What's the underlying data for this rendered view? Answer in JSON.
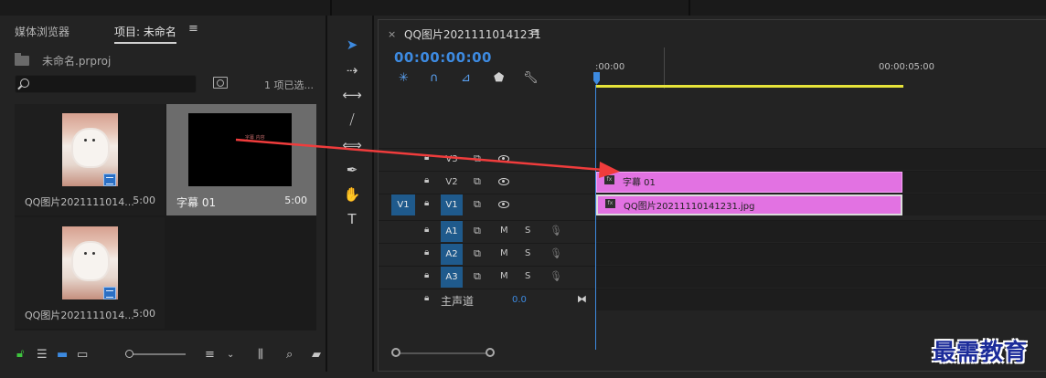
{
  "project_panel": {
    "tabs": [
      "媒体浏览器",
      "项目: 未命名"
    ],
    "menu_icon": "≡",
    "file_name": "未命名.prproj",
    "search_placeholder": "",
    "selection_count": "1 项已选...",
    "items": [
      {
        "name": "QQ图片2021111014...",
        "duration": "5:00",
        "type": "image",
        "badge": "image-icon"
      },
      {
        "name": "字幕 01",
        "duration": "5:00",
        "type": "title",
        "selected": true,
        "thumb_text": "字幕 内容"
      },
      {
        "name": "QQ图片2021111014...",
        "duration": "5:00",
        "type": "image",
        "badge": "sequence-icon"
      }
    ]
  },
  "tools": [
    "selection-tool",
    "track-select-tool",
    "ripple-edit-tool",
    "razor-tool",
    "slip-tool",
    "pen-tool",
    "hand-tool",
    "type-tool"
  ],
  "timeline": {
    "sequence_name": "QQ图片20211110141231",
    "close_symbol": "×",
    "menu_icon": "≡",
    "timecode": "00:00:00:00",
    "ruler_labels": [
      ":00:00",
      "00:00:05:00"
    ],
    "video_tracks": [
      {
        "name": "V3",
        "source_patch": ""
      },
      {
        "name": "V2",
        "source_patch": ""
      },
      {
        "name": "V1",
        "source_patch": "V1"
      }
    ],
    "audio_tracks": [
      {
        "name": "A1",
        "m": "M",
        "s": "S"
      },
      {
        "name": "A2",
        "m": "M",
        "s": "S"
      },
      {
        "name": "A3",
        "m": "M",
        "s": "S"
      }
    ],
    "master": {
      "label": "主声道",
      "value": "0.0"
    },
    "clips": [
      {
        "track": "V2",
        "label": "字幕 01",
        "fx": "fx"
      },
      {
        "track": "V1",
        "label": "QQ图片20211110141231.jpg",
        "fx": "fx"
      }
    ]
  },
  "watermark": "最需教育",
  "colors": {
    "accent": "#3d8ae0",
    "clip": "#e272e2",
    "arrow": "#f03c3c",
    "workarea": "#e6e33a"
  }
}
